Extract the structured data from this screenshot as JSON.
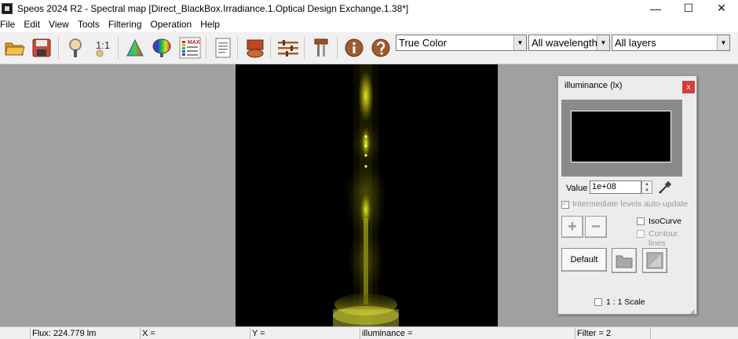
{
  "window": {
    "title": "Speos 2024 R2 - Spectral map [Direct_BlackBox.Irradiance.1.Optical Design Exchange.1.38*]",
    "controls": {
      "minimize": "—",
      "maximize": "☐",
      "close": "✕"
    }
  },
  "menu": {
    "items": [
      "File",
      "Edit",
      "View",
      "Tools",
      "Filtering",
      "Operation",
      "Help"
    ]
  },
  "toolbar": {
    "ratio_label": "1:1",
    "max_label": "MAX",
    "icons": [
      "open-folder-icon",
      "save-icon",
      "magnifier-icon",
      "ratio-1-1-icon",
      "color-triangle-icon",
      "spectrum-icon",
      "max-scale-icon",
      "document-icon",
      "shape-icon",
      "settings-sliders-icon",
      "tools-icon",
      "info-icon",
      "help-icon"
    ],
    "color_mode": {
      "value": "True Color"
    },
    "wavelengths": {
      "value": "All wavelengths"
    },
    "layers": {
      "value": "All layers"
    }
  },
  "panel": {
    "title": "illuminance (lx)",
    "close_label": "x",
    "value_label": "Value",
    "value": "1e+08",
    "auto_update_label": "Intermediate levels auto-update",
    "isocurve_label": "IsoCurve",
    "contour_label": "Contour lines",
    "plus_label": "+",
    "minus_label": "−",
    "default_label": "Default",
    "scale_label": "1 : 1 Scale"
  },
  "status": {
    "flux": "Flux: 224.779 lm",
    "x": "X =",
    "y": "Y =",
    "illuminance": "illuminance =",
    "filter": "Filter = 2"
  },
  "colors": {
    "canvas_bg": "#a0a0a0",
    "map_bg": "#000000",
    "beam": "#e8e800",
    "panel_close": "#d83b3b"
  }
}
